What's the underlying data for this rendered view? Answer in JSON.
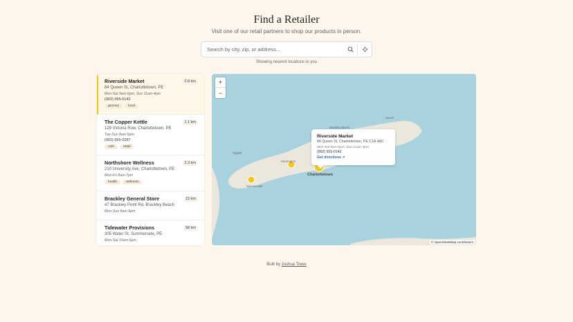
{
  "header": {
    "title": "Find a Retailer",
    "subtitle": "Visit one of our retail partners to shop our products in person."
  },
  "search": {
    "placeholder": "Search by city, zip, or address...",
    "search_icon": "search-icon",
    "locate_icon": "crosshair-icon"
  },
  "status": "Showing nearest locations to you",
  "retailers": [
    {
      "name": "Riverside Market",
      "distance": "0.8 km",
      "address": "84 Queen St, Charlottetown, PE",
      "hours": "Mon-Sat 9am-6pm, Sun 11am-4pm",
      "phone": "(902) 555-0142",
      "tags": [
        "grocery",
        "local"
      ]
    },
    {
      "name": "The Copper Kettle",
      "distance": "1.1 km",
      "address": "129 Victoria Row, Charlottetown, PE",
      "hours": "Tue-Sun 8am-5pm",
      "phone": "(902) 555-0287",
      "tags": [
        "cafe",
        "retail"
      ]
    },
    {
      "name": "Northshore Wellness",
      "distance": "2.3 km",
      "address": "210 University Ave, Charlottetown, PE",
      "hours": "Mon-Fri 8am-7pm",
      "phone": "",
      "tags": [
        "health",
        "wellness"
      ]
    },
    {
      "name": "Brackley General Store",
      "distance": "15 km",
      "address": "47 Brackley Point Rd, Brackley Beach",
      "hours": "Mon-Sun 8am-9pm",
      "phone": "",
      "tags": []
    },
    {
      "name": "Tidewater Provisions",
      "distance": "58 km",
      "address": "305 Water St, Summerside, PE",
      "hours": "Mon-Sat 10am-6pm",
      "phone": "",
      "tags": []
    }
  ],
  "map": {
    "zoom_in": "+",
    "zoom_out": "−",
    "labels": {
      "tignish": "Tignish",
      "summerside": "Summerside",
      "charlottetown": "Charlottetown",
      "souris": "Souris",
      "north": "Brackley Beach",
      "kensington": "Kensington"
    },
    "popup": {
      "name": "Riverside Market",
      "address": "84 Queen St, Charlottetown, PE C1A 4A0",
      "hours": "Mon-Sat 9am-6pm, Sun 11am-4pm",
      "phone": "(902) 555-0142",
      "directions": "Get directions ↗"
    },
    "attribution": "© OpenStreetMap contributors",
    "colors": {
      "water": "#a8d2dd",
      "land": "#ebe7dc",
      "marker": "#f5c518"
    }
  },
  "footer": {
    "prefix": "Built by",
    "author": "Joshua Trees"
  }
}
